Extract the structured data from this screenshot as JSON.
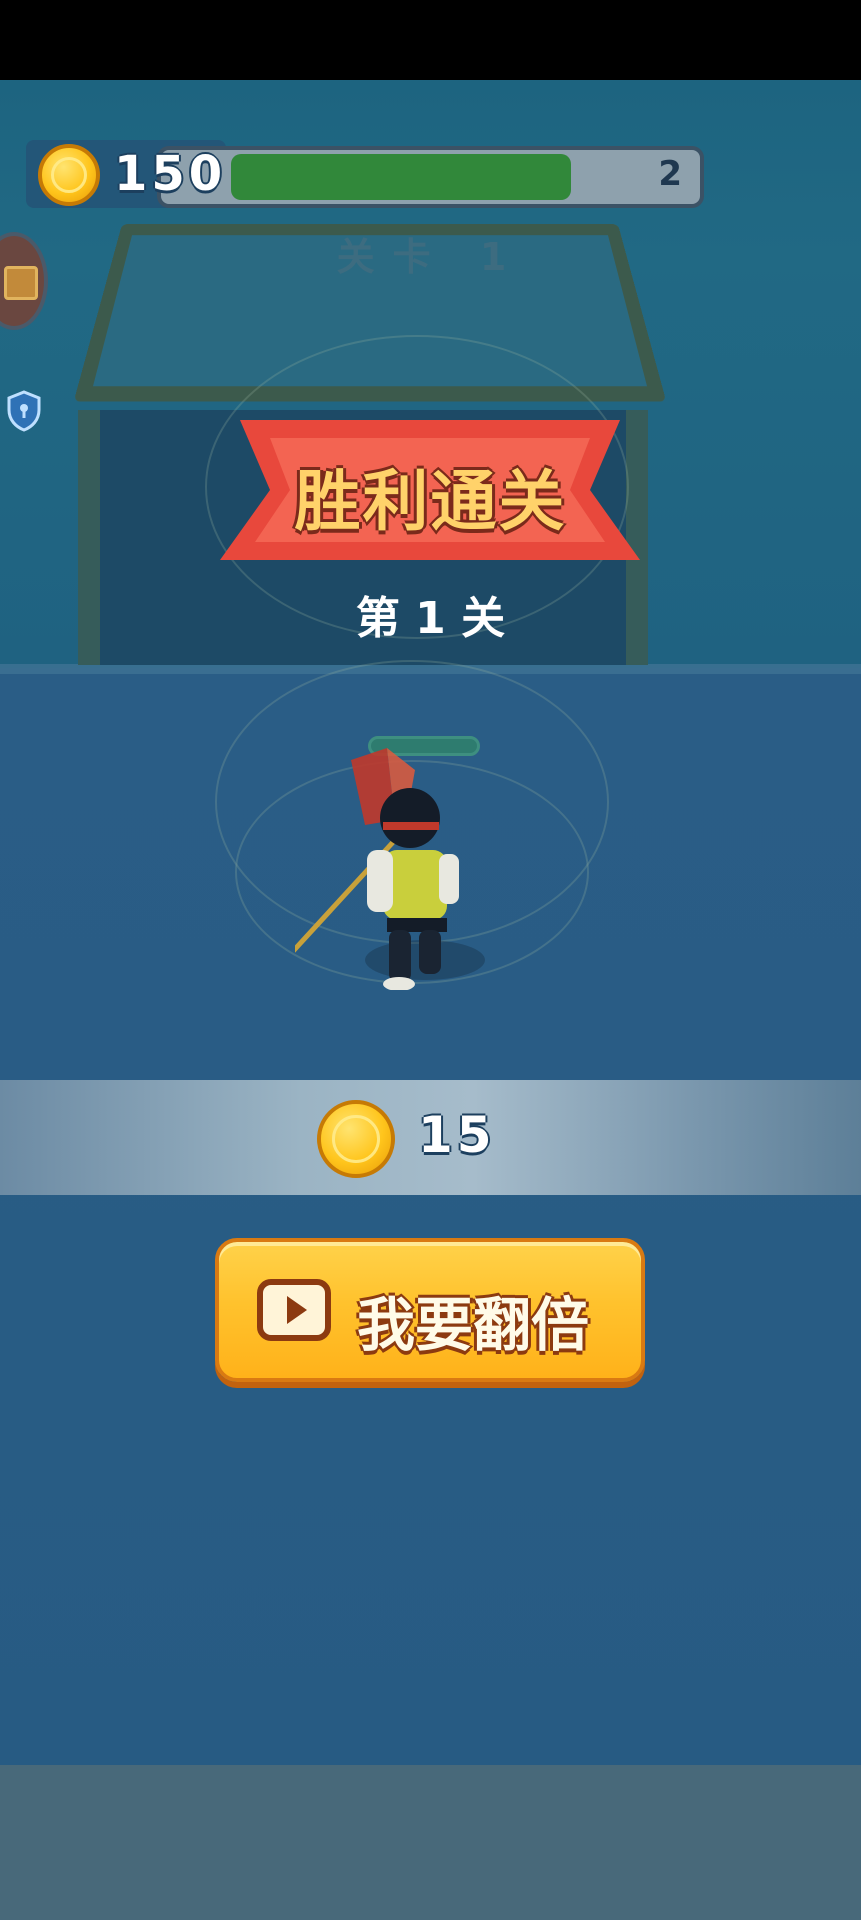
{
  "hud": {
    "coin_total": "150",
    "level_progress": 0.85,
    "next_level": "2",
    "level_label": "关卡 1"
  },
  "result": {
    "title": "胜利通关",
    "level_text": "第 1 关"
  },
  "reward": {
    "coin_amount": "15"
  },
  "double_button": {
    "label": "我要翻倍",
    "icon": "video-play-icon"
  },
  "colors": {
    "button_gold": "#ffc22d",
    "banner_red": "#e8483c",
    "progress_green": "#31883a",
    "title_gold": "#ffd26a"
  }
}
